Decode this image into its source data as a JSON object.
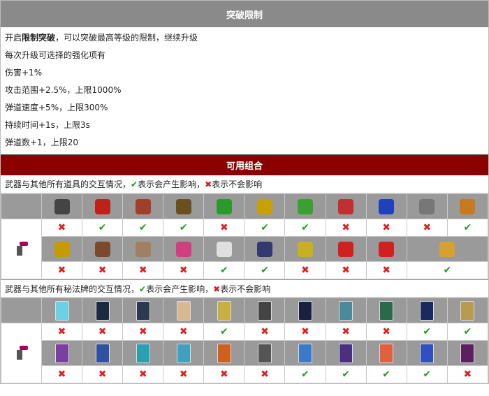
{
  "header": {
    "title": "突破限制"
  },
  "description": {
    "line1_pre": "开启",
    "line1_bold": "限制突破",
    "line1_post": "，可以突破最高等级的限制，继续升级",
    "lines": [
      "每次升级可选择的强化项有",
      "伤害+1%",
      "攻击范围+2.5%，上限1000%",
      "弹道速度+5%，上限300%",
      "持续时间+1s，上限3s",
      "弹道数+1，上限20"
    ]
  },
  "combo": {
    "title": "可用组合"
  },
  "items_note": {
    "pre": "武器与其他所有道具的交互情况，",
    "yes": "表示会产生影响，",
    "no": "表示不会影响"
  },
  "cards_note": {
    "pre": "武器与其他所有秘法牌的交互情况，",
    "yes": "表示会产生影响，",
    "no": "表示不会影响"
  },
  "symbols": {
    "yes": "✔",
    "no": "✖"
  },
  "items_row1": {
    "icons": [
      "heart-dark-icon",
      "red-book-icon",
      "bracer-icon",
      "candelabra-icon",
      "clover-icon",
      "crown-box-icon",
      "feather-icon",
      "broken-heart-icon",
      "blue-orb-icon",
      "gear-skull-icon",
      "ring-icon"
    ],
    "colors": [
      "#444",
      "#c0201a",
      "#a0402a",
      "#6a5020",
      "#2a9a2a",
      "#c8a000",
      "#3aa030",
      "#c03030",
      "#2040c0",
      "#777",
      "#c87a20"
    ],
    "marks": [
      "n",
      "y",
      "y",
      "y",
      "n",
      "y",
      "y",
      "n",
      "n",
      "n",
      "y"
    ]
  },
  "items_row2": {
    "icons": [
      "gold-crown-icon",
      "chest-icon",
      "skull-face-icon",
      "pink-skull-icon",
      "wings-icon",
      "dark-ring-icon",
      "gold-ring-icon",
      "red-arrow-right-icon",
      "red-arrow-left-icon",
      "gold-bar-icon"
    ],
    "colors": [
      "#c89a00",
      "#7a4a2a",
      "#a08060",
      "#d04080",
      "#e0e0e0",
      "#303a70",
      "#c8b020",
      "#d02020",
      "#d02020",
      "#d8a030"
    ],
    "marks": [
      "n",
      "n",
      "n",
      "n",
      "y",
      "y",
      "n",
      "n",
      "n",
      "y"
    ]
  },
  "cards_row1": {
    "icons": [
      "card-ice-icon",
      "card-dark-icon",
      "card-swirl-icon",
      "card-altar-icon",
      "card-gold-icon",
      "card-burst-icon",
      "card-portal-icon",
      "card-wind-icon",
      "card-tree-icon",
      "card-night-icon",
      "card-relic-icon"
    ],
    "colors": [
      "#6ad0e8",
      "#1a2a40",
      "#2a3a50",
      "#d8b890",
      "#c8b040",
      "#444",
      "#1a2040",
      "#4a8a9a",
      "#2a6a4a",
      "#1a2a60",
      "#b89a50"
    ],
    "marks": [
      "n",
      "n",
      "n",
      "n",
      "y",
      "n",
      "n",
      "n",
      "n",
      "y",
      "y"
    ]
  },
  "cards_row2": {
    "icons": [
      "card-purple-icon",
      "card-blue-icon",
      "card-teal-icon",
      "card-cyan-icon",
      "card-flame-icon",
      "card-script-icon",
      "card-bolt-icon",
      "card-mage-icon",
      "card-sun-icon",
      "card-comet-icon",
      "card-eye-icon"
    ],
    "colors": [
      "#7a40a0",
      "#3050a0",
      "#2aa0b0",
      "#40a0c0",
      "#d06020",
      "#555",
      "#3a7ac8",
      "#4a3080",
      "#e06040",
      "#3050c0",
      "#5a2060"
    ],
    "marks": [
      "n",
      "n",
      "n",
      "n",
      "n",
      "n",
      "y",
      "y",
      "y",
      "y",
      "n"
    ]
  }
}
